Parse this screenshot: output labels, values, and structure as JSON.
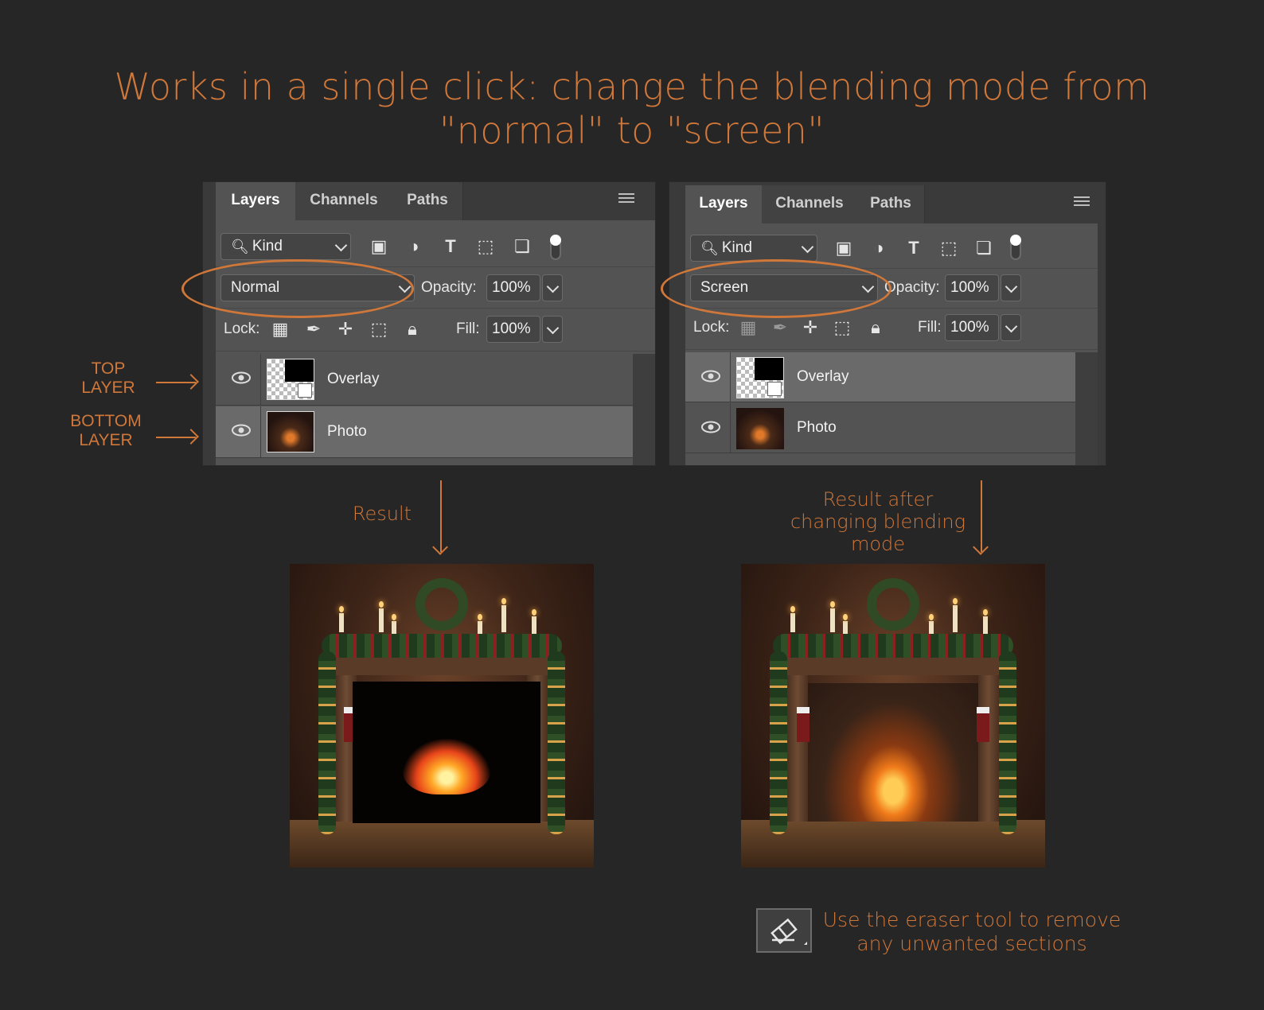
{
  "headline": {
    "line1": "Works in a single click: change the blending mode from",
    "line2": "\"normal\" to \"screen\""
  },
  "tabs": [
    "Layers",
    "Channels",
    "Paths"
  ],
  "left_panel": {
    "kind_label": "Kind",
    "blend_mode": "Normal",
    "opacity_label": "Opacity:",
    "opacity_value": "100%",
    "lock_label": "Lock:",
    "fill_label": "Fill:",
    "fill_value": "100%",
    "layers": [
      {
        "name": "Overlay",
        "selected": false
      },
      {
        "name": "Photo",
        "selected": true
      }
    ]
  },
  "right_panel": {
    "kind_label": "Kind",
    "blend_mode": "Screen",
    "opacity_label": "Opacity:",
    "opacity_value": "100%",
    "lock_label": "Lock:",
    "fill_label": "Fill:",
    "fill_value": "100%",
    "layers": [
      {
        "name": "Overlay",
        "selected": true
      },
      {
        "name": "Photo",
        "selected": false
      }
    ]
  },
  "side_labels": {
    "top_l1": "TOP",
    "top_l2": "LAYER",
    "bottom_l1": "BOTTOM",
    "bottom_l2": "LAYER"
  },
  "captions": {
    "result": "Result",
    "result_after_l1": "Result after",
    "result_after_l2": "changing blending",
    "result_after_l3": "mode",
    "eraser_l1": "Use the eraser tool to remove",
    "eraser_l2": "any unwanted sections"
  },
  "colors": {
    "accent": "#d0773a",
    "background": "#262626",
    "panel": "#535353"
  },
  "icons": [
    "search-icon",
    "image-filter-icon",
    "adjustment-filter-icon",
    "type-filter-icon",
    "shape-filter-icon",
    "smart-object-filter-icon",
    "filter-toggle-icon",
    "lock-pixels-icon",
    "lock-brush-icon",
    "lock-move-icon",
    "lock-artboard-icon",
    "lock-all-icon",
    "eye-icon",
    "eraser-icon",
    "panel-menu-icon"
  ]
}
